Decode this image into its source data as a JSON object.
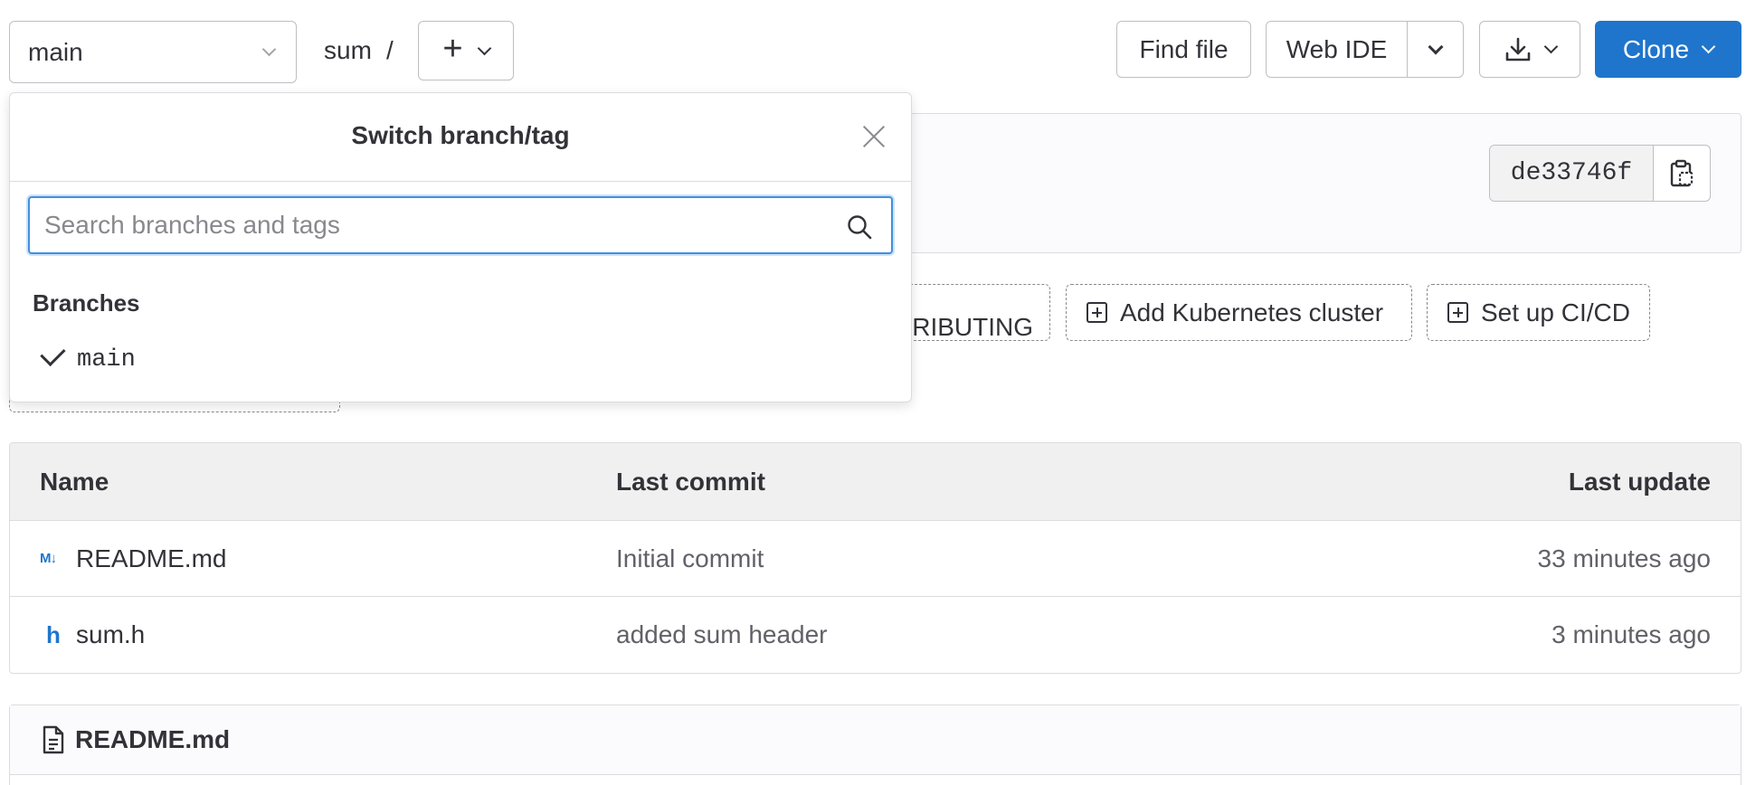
{
  "toolbar": {
    "branch": "main",
    "project": "sum",
    "separator": "/",
    "find_file": "Find file",
    "web_ide": "Web IDE",
    "clone": "Clone"
  },
  "commit": {
    "sha": "de33746f"
  },
  "quick_actions": {
    "contributing": "Add CONTRIBUTING",
    "kubernetes": "Add Kubernetes cluster",
    "cicd": "Set up CI/CD"
  },
  "table": {
    "headers": {
      "name": "Name",
      "last_commit": "Last commit",
      "last_update": "Last update"
    },
    "rows": [
      {
        "icon": "markdown-icon",
        "name": "README.md",
        "commit": "Initial commit",
        "updated": "33 minutes ago"
      },
      {
        "icon": "header-file-icon",
        "name": "sum.h",
        "commit": "added sum header",
        "updated": "3 minutes ago"
      }
    ]
  },
  "readme": {
    "title": "README.md"
  },
  "dropdown": {
    "title": "Switch branch/tag",
    "search_placeholder": "Search branches and tags",
    "section": "Branches",
    "items": [
      {
        "name": "main",
        "selected": true
      }
    ]
  },
  "colors": {
    "primary": "#1f75cb",
    "focus": "#428fdc"
  }
}
